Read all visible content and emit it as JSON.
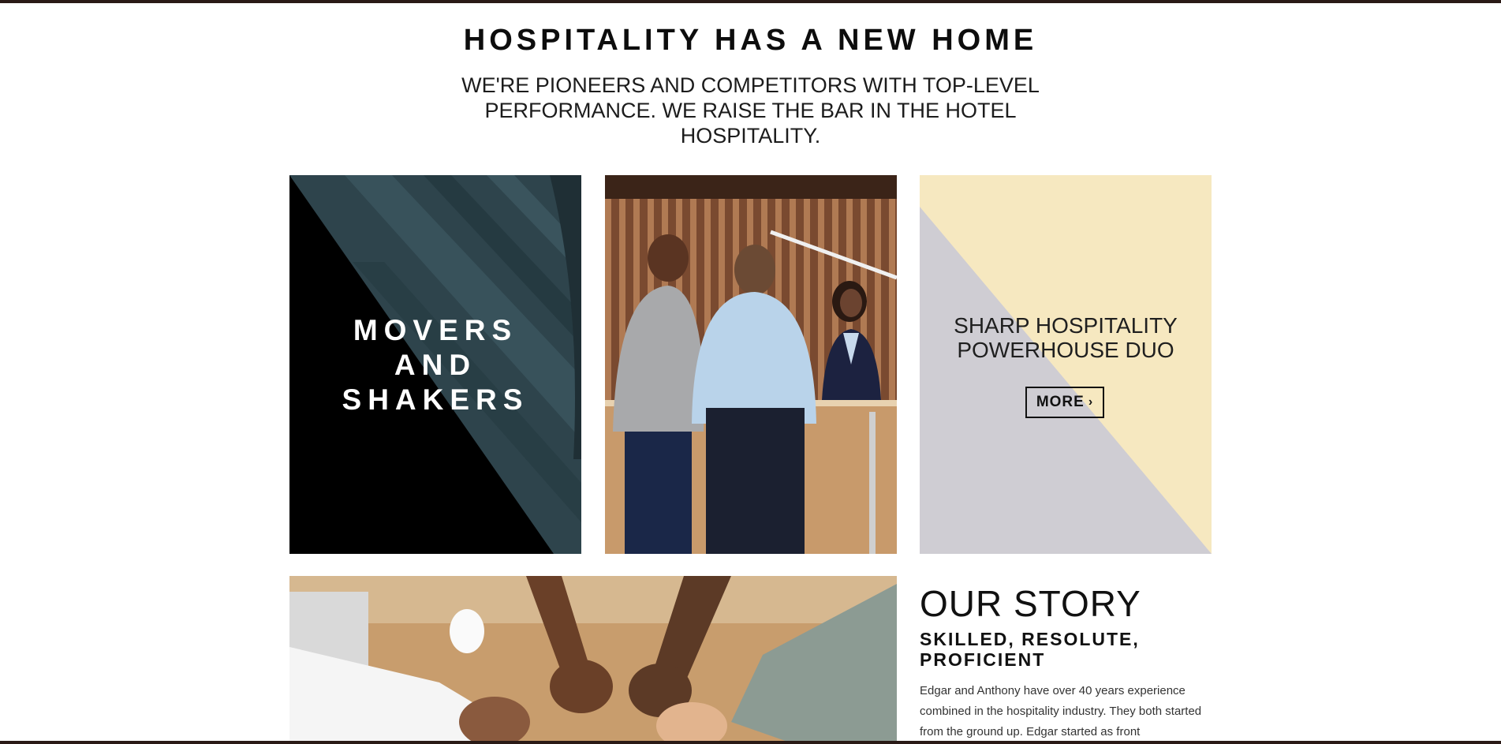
{
  "hero": {
    "title": "HOSPITALITY HAS A NEW HOME",
    "subtitle": "WE'RE PIONEERS AND COMPETITORS WITH TOP-LEVEL PERFORMANCE. WE RAISE THE BAR IN THE HOTEL HOSPITALITY."
  },
  "cards": {
    "movers": {
      "line1": "MOVERS",
      "line2": "AND",
      "line3": "SHAKERS"
    },
    "duo": {
      "line1": "SHARP HOSPITALITY",
      "line2": "POWERHOUSE DUO",
      "button_label": "MORE",
      "button_icon": "chevron-right-icon"
    }
  },
  "story": {
    "heading": "OUR STORY",
    "subheading": "SKILLED, RESOLUTE, PROFICIENT",
    "body": "Edgar and Anthony have over 40 years experience combined in the hospitality industry. They both started from the ground up. Edgar started as front"
  },
  "colors": {
    "top_bar": "#2a1a16",
    "movers_dark": "#000000",
    "movers_slate": "#2e444c",
    "duo_cream": "#f6e8c0",
    "duo_gray": "#cfcdd3"
  }
}
